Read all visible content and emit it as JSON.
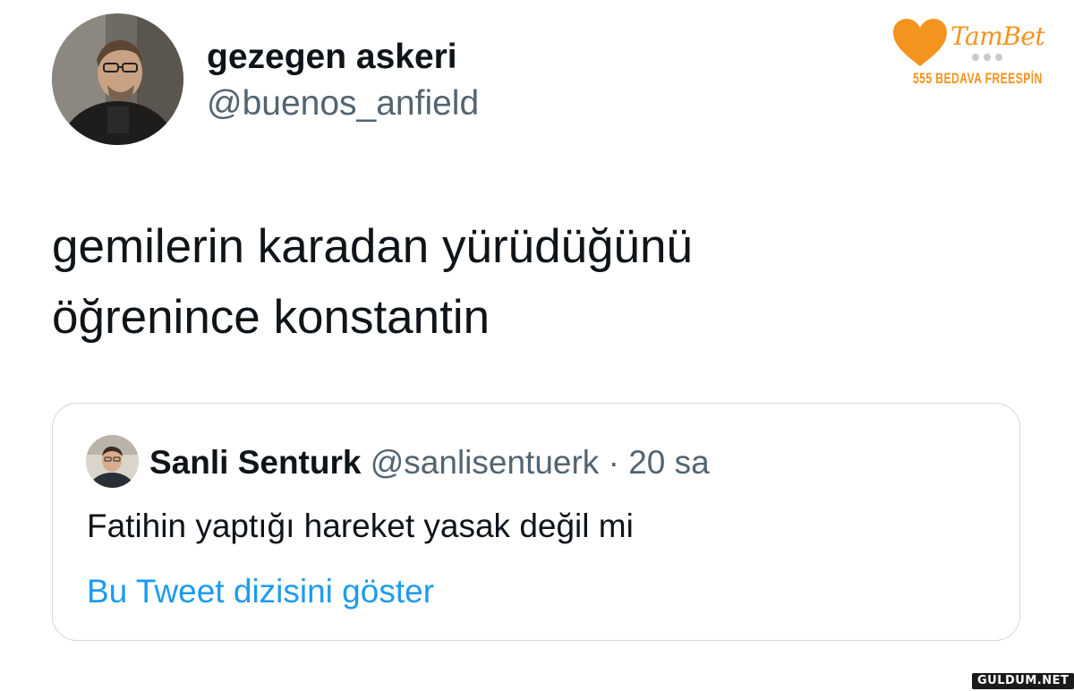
{
  "author": {
    "display_name": "gezegen askeri",
    "handle": "@buenos_anfield"
  },
  "tweet": {
    "lines": [
      "gemilerin karadan yürüdüğünü",
      "öğrenince konstantin"
    ]
  },
  "quoted_tweet": {
    "display_name": "Sanli Senturk",
    "handle": "@sanlisentuerk",
    "separator": "·",
    "time": "20 sa",
    "text": "Fatihin yaptığı hareket yasak değil mi",
    "show_thread_label": "Bu Tweet dizisini göster"
  },
  "brand": {
    "name": "TamBet",
    "tagline": "555 BEDAVA FREESPİN",
    "icon": "heart-icon",
    "color": "#f5931f"
  },
  "watermark": {
    "text": "GULDUM.NET"
  },
  "colors": {
    "text_primary": "#0f1419",
    "text_secondary": "#536471",
    "link": "#1d9bf0",
    "border": "#cfd9de"
  }
}
